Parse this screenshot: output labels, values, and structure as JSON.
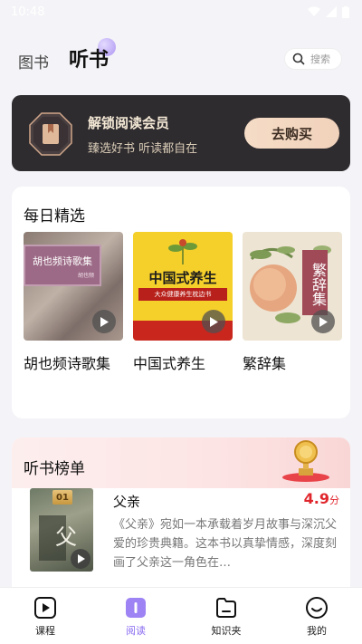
{
  "status": {
    "time": "10:48"
  },
  "tabs": {
    "books": "图书",
    "listen": "听书"
  },
  "search": {
    "placeholder": "搜索"
  },
  "vip": {
    "title": "解锁阅读会员",
    "subtitle": "臻选好书 听读都自在",
    "button": "去购买"
  },
  "daily": {
    "title": "每日精选",
    "books": [
      {
        "name": "胡也频诗歌集",
        "cover_title": "胡也频诗歌集",
        "cover_author": "胡也频"
      },
      {
        "name": "中国式养生",
        "cover_title": "中国式养生",
        "cover_sub": "大众健康养生枕边书"
      },
      {
        "name": "繁辞集",
        "cover_title": "繁辞集"
      }
    ]
  },
  "ranking": {
    "title": "听书榜单",
    "items": [
      {
        "rank": "01",
        "name": "父亲",
        "score": "4.9",
        "score_unit": "分",
        "description": "《父亲》宛如一本承载着岁月故事与深沉父爱的珍贵典籍。这本书以真挚情感，深度刻画了父亲这一角色在…"
      }
    ]
  },
  "nav": {
    "course": "课程",
    "read": "阅读",
    "knowledge": "知识夹",
    "mine": "我的"
  },
  "colors": {
    "accent": "#8a6bf0",
    "score": "#e0262d",
    "vip_bg": "#2f2c2f"
  }
}
